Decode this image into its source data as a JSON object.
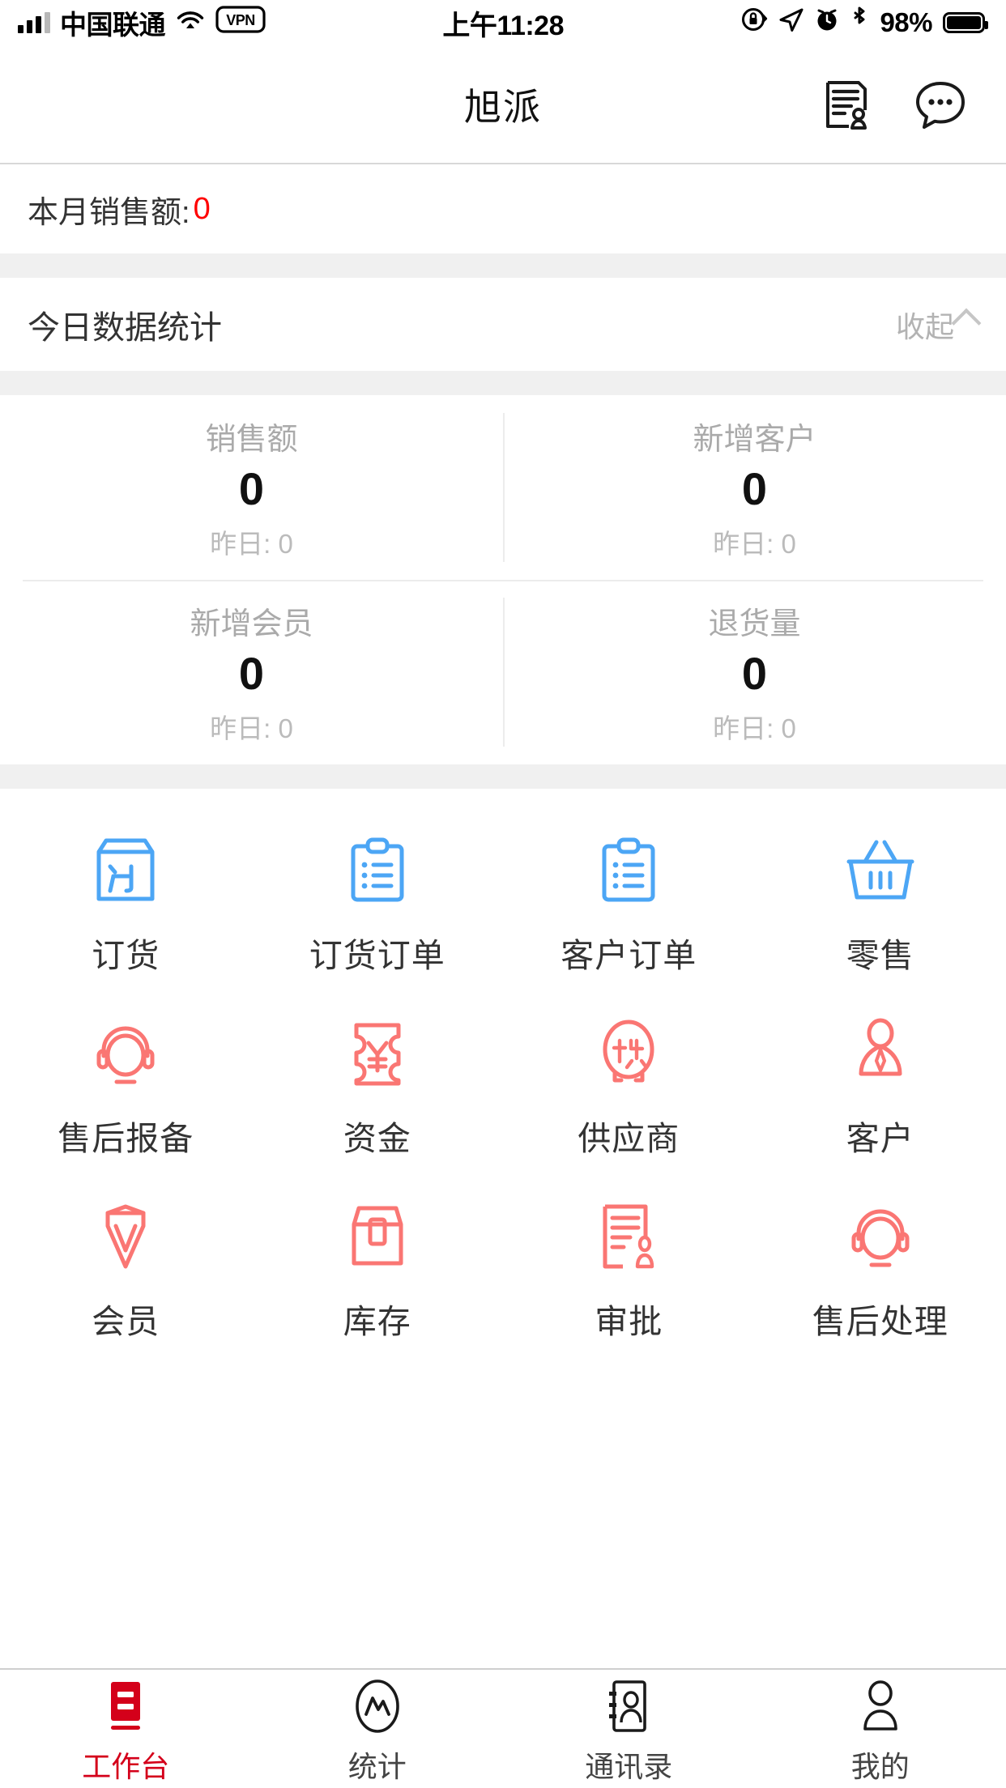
{
  "status_bar": {
    "carrier": "中国联通",
    "wifi_icon": "wifi-icon",
    "vpn_label": "VPN",
    "time": "上午11:28",
    "rotation_lock_icon": "rotation-lock-icon",
    "location_icon": "location-arrow-icon",
    "alarm_icon": "alarm-clock-icon",
    "bluetooth_icon": "bluetooth-icon",
    "battery_percent": "98%"
  },
  "nav": {
    "title": "旭派",
    "actions": [
      {
        "name": "contract-icon",
        "label": "contract"
      },
      {
        "name": "chat-bubble-icon",
        "label": "chat"
      }
    ]
  },
  "month_sales": {
    "label": "本月销售额:",
    "value": "0",
    "value_color": "#ff0000"
  },
  "today_stats": {
    "title": "今日数据统计",
    "collapse_label": "收起",
    "cards": [
      {
        "label": "销售额",
        "value": "0",
        "sub": "昨日: 0"
      },
      {
        "label": "新增客户",
        "value": "0",
        "sub": "昨日: 0"
      },
      {
        "label": "新增会员",
        "value": "0",
        "sub": "昨日: 0"
      },
      {
        "label": "退货量",
        "value": "0",
        "sub": "昨日: 0"
      }
    ]
  },
  "app_grid": {
    "accent_blue": "#4ca6f5",
    "accent_red": "#fa7673",
    "rows": [
      [
        {
          "label": "订货",
          "icon": "order-box-icon",
          "color": "#4ca6f5"
        },
        {
          "label": "订货订单",
          "icon": "clipboard-list-icon",
          "color": "#4ca6f5"
        },
        {
          "label": "客户订单",
          "icon": "clipboard-list-icon",
          "color": "#4ca6f5"
        },
        {
          "label": "零售",
          "icon": "shopping-basket-icon",
          "color": "#4ca6f5"
        }
      ],
      [
        {
          "label": "售后报备",
          "icon": "headset-icon",
          "color": "#fa7673"
        },
        {
          "label": "资金",
          "icon": "yuan-ticket-icon",
          "color": "#fa7673"
        },
        {
          "label": "供应商",
          "icon": "supplier-badge-icon",
          "color": "#fa7673"
        },
        {
          "label": "客户",
          "icon": "customer-person-icon",
          "color": "#fa7673"
        }
      ],
      [
        {
          "label": "会员",
          "icon": "member-diamond-icon",
          "color": "#fa7673"
        },
        {
          "label": "库存",
          "icon": "inventory-box-icon",
          "color": "#fa7673"
        },
        {
          "label": "审批",
          "icon": "approval-stamp-icon",
          "color": "#fa7673"
        },
        {
          "label": "售后处理",
          "icon": "headset-icon",
          "color": "#fa7673"
        }
      ]
    ]
  },
  "tab_bar": {
    "active_color": "#d4001a",
    "tabs": [
      {
        "label": "工作台",
        "icon": "workbench-icon",
        "active": true
      },
      {
        "label": "统计",
        "icon": "statistics-icon",
        "active": false
      },
      {
        "label": "通讯录",
        "icon": "contacts-book-icon",
        "active": false
      },
      {
        "label": "我的",
        "icon": "profile-person-icon",
        "active": false
      }
    ]
  }
}
